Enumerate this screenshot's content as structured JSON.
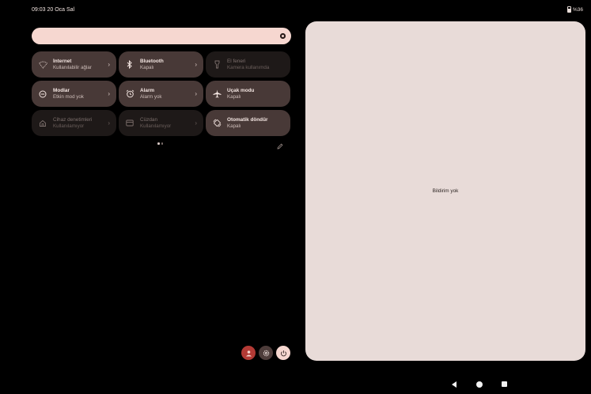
{
  "status_bar": {
    "time_date": "09:03  20 Oca Sal",
    "battery": "%36"
  },
  "quick_settings": {
    "brightness_level": 0.97,
    "tiles": [
      {
        "id": "internet",
        "title": "İnternet",
        "subtitle": "Kullanılabilir ağlar",
        "icon": "wifi-icon",
        "state": "active",
        "chevron": "›"
      },
      {
        "id": "bluetooth",
        "title": "Bluetooth",
        "subtitle": "Kapalı",
        "icon": "bluetooth-icon",
        "state": "active",
        "chevron": "›"
      },
      {
        "id": "flashlight",
        "title": "El feneri",
        "subtitle": "Kamera kullanımda",
        "icon": "flashlight-icon",
        "state": "disabled",
        "chevron": ""
      },
      {
        "id": "modes",
        "title": "Modlar",
        "subtitle": "Etkin mod yok",
        "icon": "modes-icon",
        "state": "active",
        "chevron": "›"
      },
      {
        "id": "alarm",
        "title": "Alarm",
        "subtitle": "Alarm yok",
        "icon": "alarm-icon",
        "state": "active",
        "chevron": "›"
      },
      {
        "id": "airplane",
        "title": "Uçak modu",
        "subtitle": "Kapalı",
        "icon": "airplane-icon",
        "state": "active",
        "chevron": ""
      },
      {
        "id": "device-controls",
        "title": "Cihaz denetimleri",
        "subtitle": "Kullanılamıyor",
        "icon": "home-icon",
        "state": "disabled",
        "chevron": "›"
      },
      {
        "id": "wallet",
        "title": "Cüzdan",
        "subtitle": "Kullanılamıyor",
        "icon": "wallet-icon",
        "state": "disabled",
        "chevron": "›"
      },
      {
        "id": "auto-rotate",
        "title": "Otomatik döndür",
        "subtitle": "Kapalı",
        "icon": "rotate-icon",
        "state": "active",
        "chevron": ""
      }
    ],
    "page_indicator": {
      "current": 1,
      "total": 2
    }
  },
  "notifications": {
    "empty_text": "Bildirim yok"
  },
  "footer_buttons": [
    "user-icon",
    "gear-icon",
    "power-icon"
  ],
  "nav_bar": [
    "back-icon",
    "home-icon",
    "recents-icon"
  ],
  "colors": {
    "accent": "#f6d7d0",
    "tile_active": "#483937",
    "tile_disabled": "#1e1918",
    "panel": "#e8dbd8",
    "user_button": "#b33a35"
  }
}
